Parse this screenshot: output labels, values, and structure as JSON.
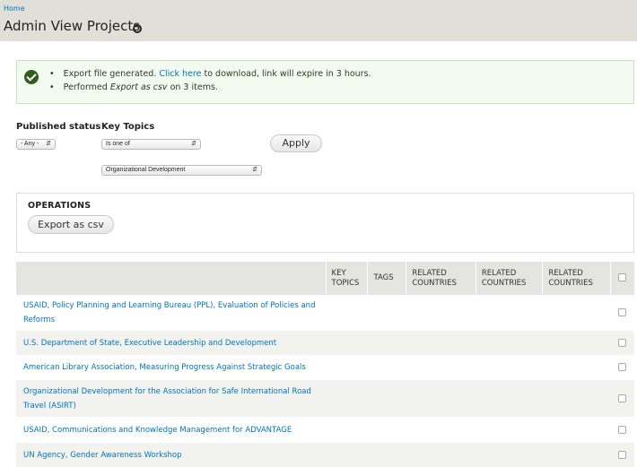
{
  "header": {
    "breadcrumb": "Home",
    "title": "Admin View Projects"
  },
  "messages": {
    "line1_prefix": "Export file generated.",
    "line1_link": "Click here",
    "line1_suffix": "to download, link will expire in 3 hours.",
    "line2_prefix": "Performed",
    "line2_action": "Export as csv",
    "line2_suffix": "on 3 items."
  },
  "filters": {
    "published_label": "Published status",
    "published_value": "- Any -",
    "key_topics_label": "Key Topics",
    "operator_value": "Is one of",
    "topic_value": "Organizational Development",
    "apply_label": "Apply"
  },
  "operations": {
    "title": "OPERATIONS",
    "export_label": "Export as csv"
  },
  "table": {
    "columns": [
      "KEY TOPICS",
      "TAGS",
      "RELATED COUNTRIES",
      "RELATED COUNTRIES",
      "RELATED COUNTRIES"
    ],
    "rows": [
      {
        "title": "USAID, Policy Planning and Learning Bureau (PPL), Evaluation of Policies and Reforms"
      },
      {
        "title": "U.S. Department of State, Executive Leadership and Development"
      },
      {
        "title": "American Library Association, Measuring Progress Against Strategic Goals"
      },
      {
        "title": "Organizational Development for the Association for Safe International Road Travel (ASIRT)"
      },
      {
        "title": "USAID, Communications and Knowledge Management for ADVANTAGE"
      },
      {
        "title": "UN Agency, Gender Awareness Workshop"
      }
    ]
  }
}
